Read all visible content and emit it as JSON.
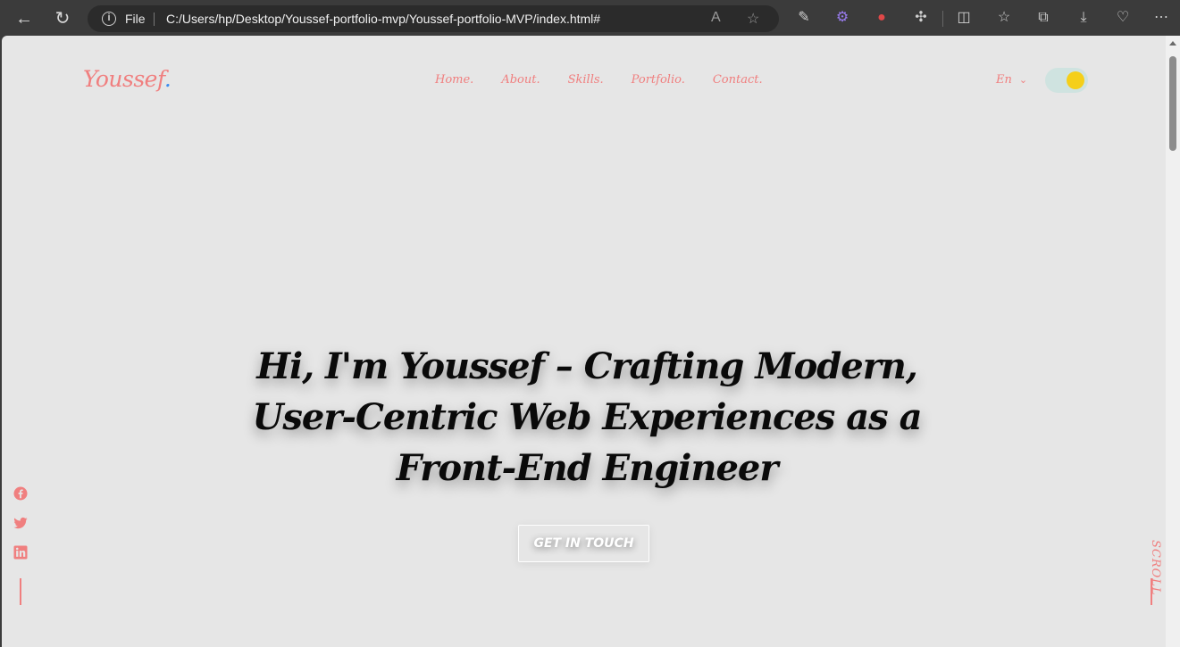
{
  "browser": {
    "protocol_label": "File",
    "url": "C:/Users/hp/Desktop/Youssef-portfolio-mvp/Youssef-portfolio-MVP/index.html#"
  },
  "site": {
    "brand": "Youssef",
    "brand_dot": ".",
    "nav": [
      "Home.",
      "About.",
      "Skills.",
      "Portfolio.",
      "Contact."
    ],
    "language": "En",
    "theme_toggle_colors": {
      "track": "#cfe3e0",
      "knob": "#f5cf1a"
    },
    "accent_color": "#f07f7f"
  },
  "hero": {
    "headline": "Hi, I'm Youssef – Crafting Modern, User-Centric Web Experiences as a Front-End Engineer",
    "cta": "GET IN TOUCH"
  },
  "social": [
    "facebook-icon",
    "twitter-icon",
    "linkedin-icon"
  ],
  "scroll_label": "SCROLL"
}
